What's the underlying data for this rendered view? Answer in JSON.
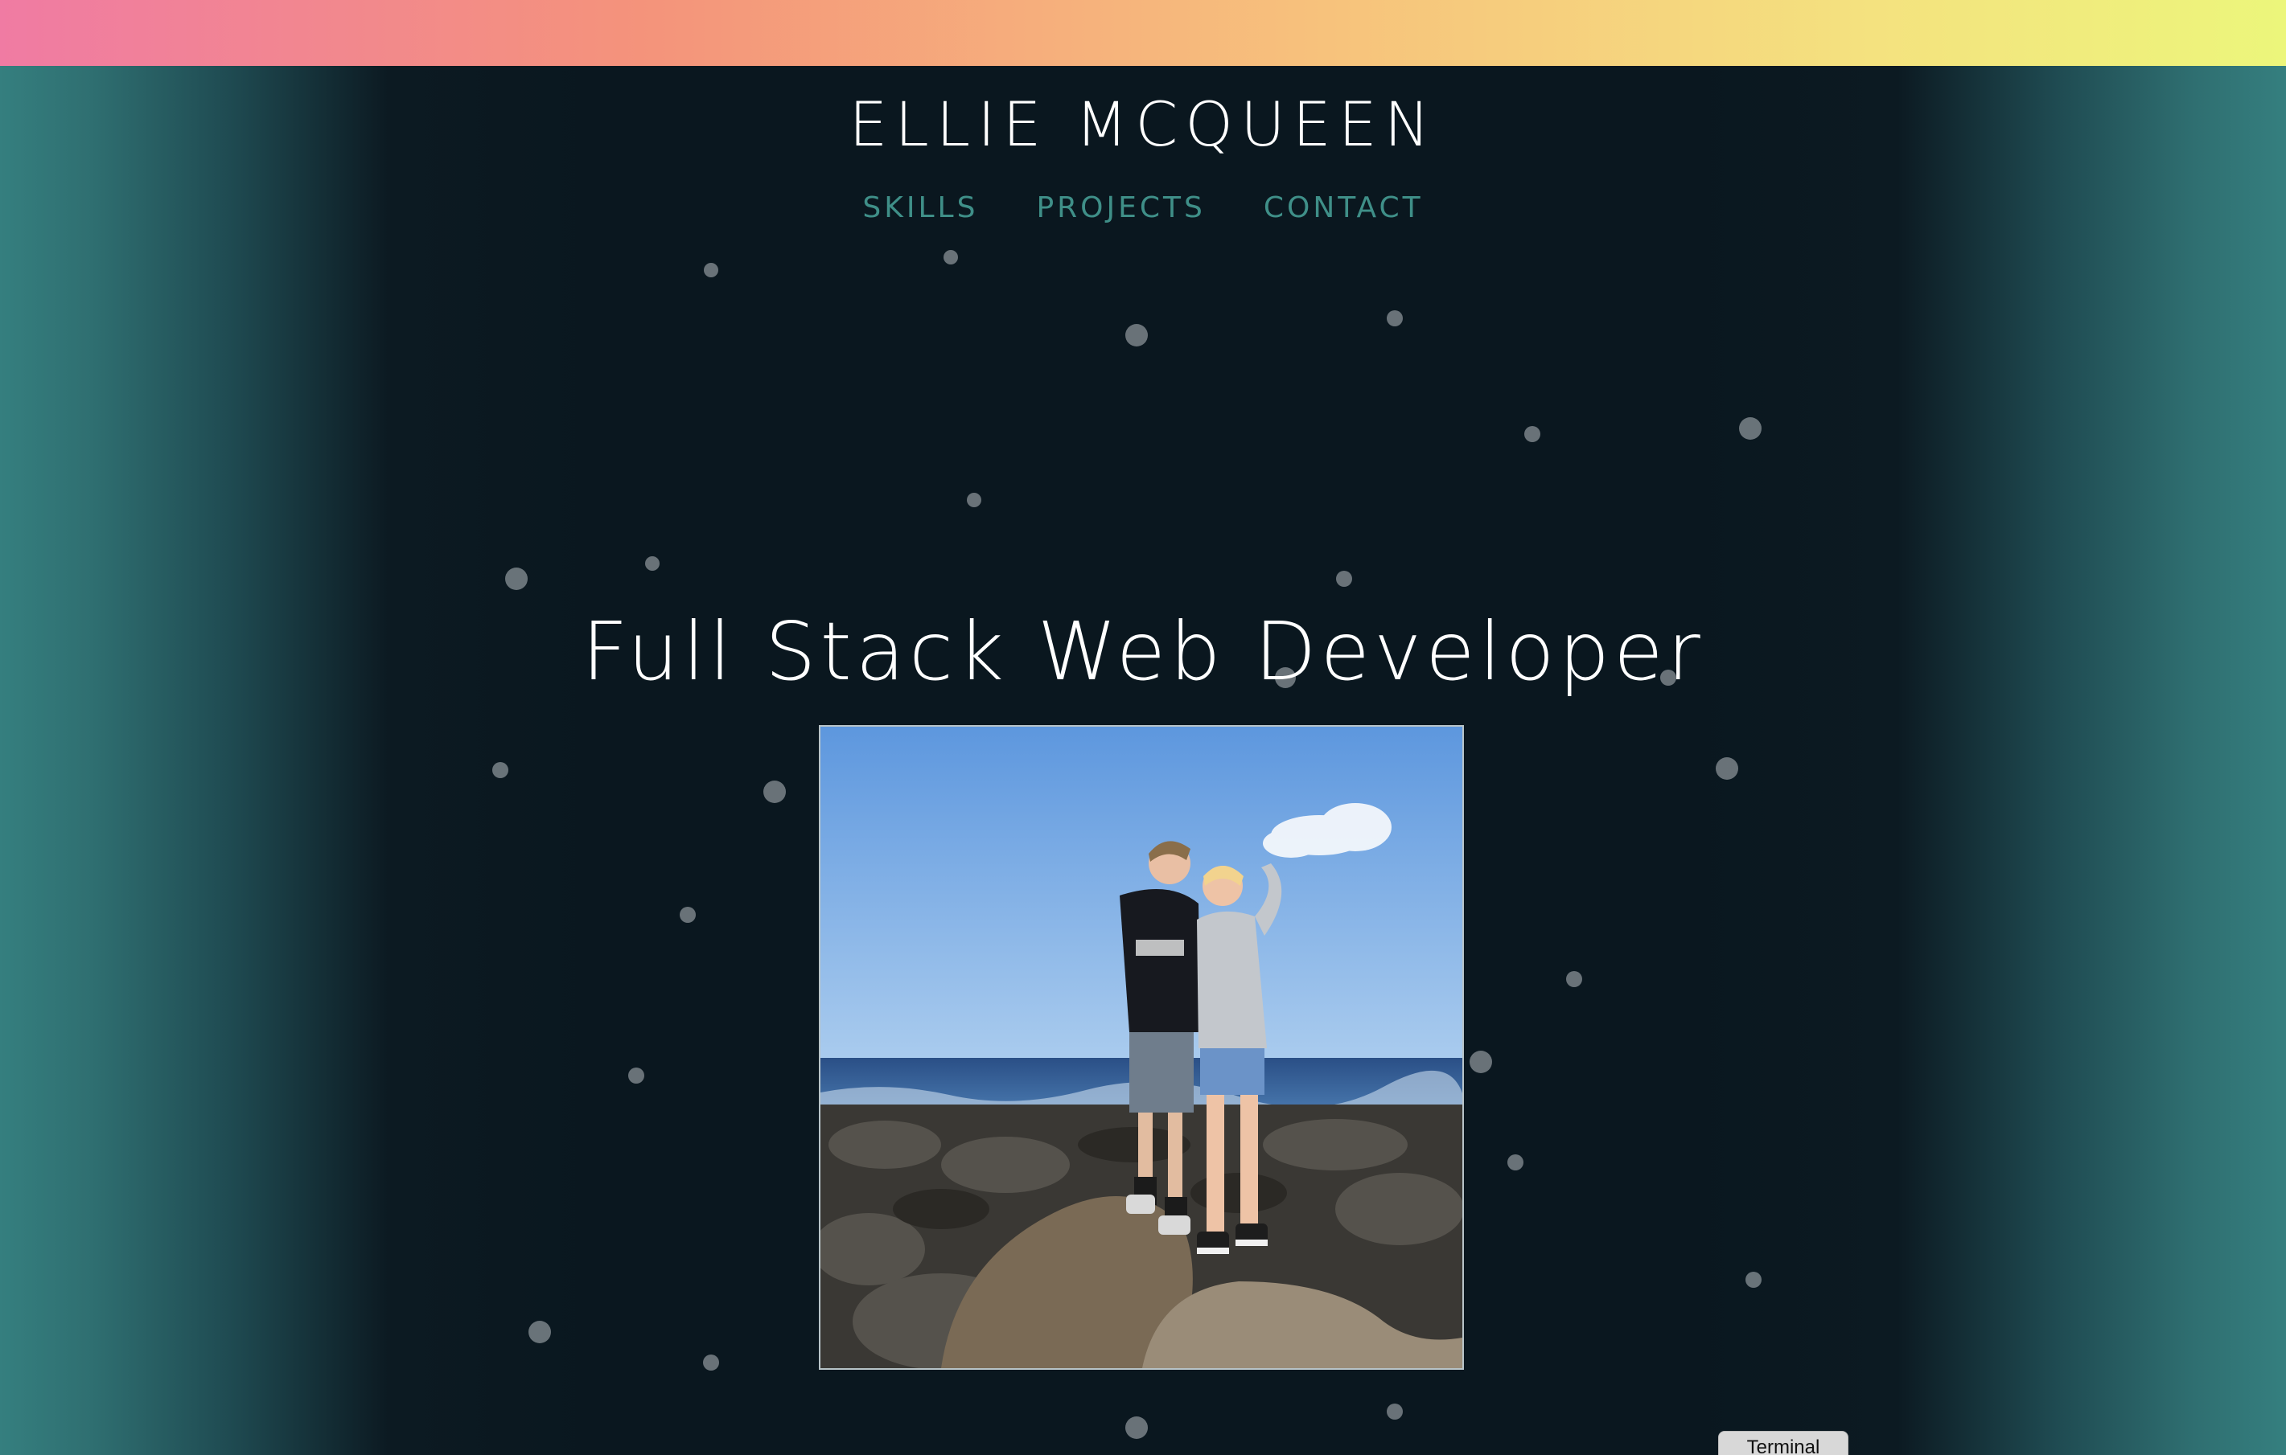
{
  "site": {
    "title": "ELLIE MCQUEEN",
    "hero_heading": "Full Stack Web Developer"
  },
  "nav": {
    "items": [
      {
        "label": "SKILLS"
      },
      {
        "label": "PROJECTS"
      },
      {
        "label": "CONTACT"
      }
    ]
  },
  "profile_photo": {
    "alt": "Two people standing on coastal rocks by the ocean"
  },
  "terminal_button": {
    "label": "Terminal"
  },
  "colors": {
    "top_bar_gradient": [
      "#f07ba3",
      "#f4937b",
      "#f7c27c",
      "#f4e27f",
      "#ecf67b"
    ],
    "page_background": "#0a171f",
    "edge_teal": "#357f7f",
    "nav_link": "#3f8f88",
    "heading_text": "#ffffff",
    "particle": "#8a9297"
  },
  "icons": {
    "particles": "floating-dots"
  }
}
